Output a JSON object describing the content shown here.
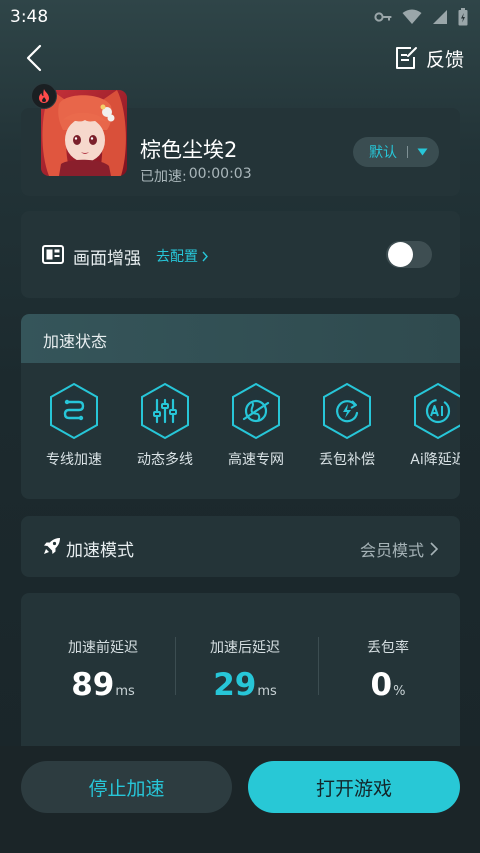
{
  "status_bar": {
    "time": "3:48"
  },
  "header": {
    "feedback_label": "反馈"
  },
  "game": {
    "title": "棕色尘埃2",
    "elapsed_label": "已加速:",
    "elapsed_value": "00:00:03",
    "mode_select_value": "默认"
  },
  "enhance": {
    "label": "画面增强",
    "config_link": "去配置",
    "enabled": false
  },
  "accel_status": {
    "title": "加速状态",
    "features": [
      {
        "label": "专线加速",
        "icon": "route-icon"
      },
      {
        "label": "动态多线",
        "icon": "sliders-icon"
      },
      {
        "label": "高速专网",
        "icon": "globe-icon"
      },
      {
        "label": "丢包补偿",
        "icon": "lightning-refresh-icon"
      },
      {
        "label": "Ai降延迟",
        "icon": "ai-icon"
      }
    ]
  },
  "accel_mode": {
    "label": "加速模式",
    "value": "会员模式"
  },
  "stats": [
    {
      "label": "加速前延迟",
      "value": "89",
      "unit": "ms"
    },
    {
      "label": "加速后延迟",
      "value": "29",
      "unit": "ms"
    },
    {
      "label": "丢包率",
      "value": "0",
      "unit": "%"
    }
  ],
  "actions": {
    "stop_label": "停止加速",
    "play_label": "打开游戏"
  },
  "colors": {
    "accent": "#27c6d8",
    "card": "#243438",
    "background": "#1c2a2e"
  }
}
